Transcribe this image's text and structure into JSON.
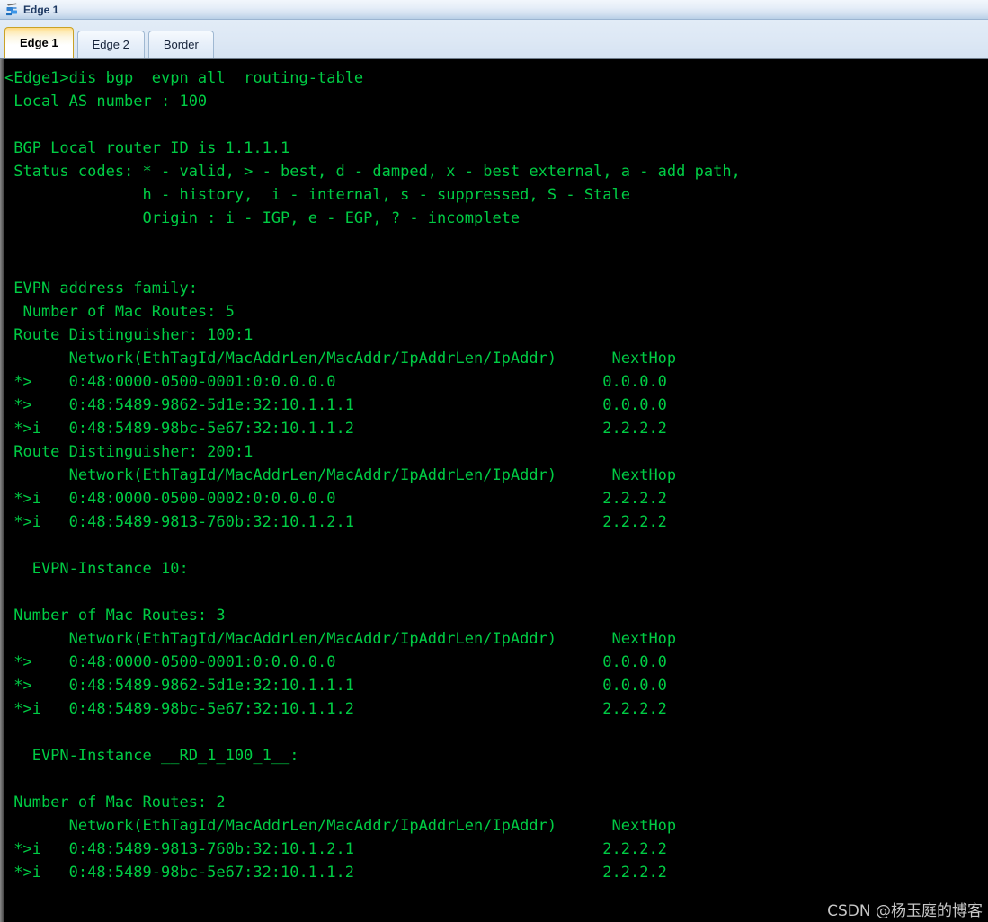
{
  "window": {
    "title": "Edge 1",
    "icon": "console-device-icon"
  },
  "tabs": [
    {
      "label": "Edge 1",
      "active": true
    },
    {
      "label": "Edge 2",
      "active": false
    },
    {
      "label": "Border",
      "active": false
    }
  ],
  "terminal": {
    "foreground_color": "#00cc44",
    "background_color": "#000000",
    "prompt": "<Edge1>",
    "command": "dis bgp  evpn all  routing-table",
    "lines": [
      "<Edge1>dis bgp  evpn all  routing-table",
      " Local AS number : 100",
      "",
      " BGP Local router ID is 1.1.1.1",
      " Status codes: * - valid, > - best, d - damped, x - best external, a - add path,",
      "               h - history,  i - internal, s - suppressed, S - Stale",
      "               Origin : i - IGP, e - EGP, ? - incomplete",
      "",
      "",
      " EVPN address family:",
      "  Number of Mac Routes: 5",
      " Route Distinguisher: 100:1",
      "       Network(EthTagId/MacAddrLen/MacAddr/IpAddrLen/IpAddr)      NextHop",
      " *>    0:48:0000-0500-0001:0:0.0.0.0                             0.0.0.0",
      " *>    0:48:5489-9862-5d1e:32:10.1.1.1                           0.0.0.0",
      " *>i   0:48:5489-98bc-5e67:32:10.1.1.2                           2.2.2.2",
      " Route Distinguisher: 200:1",
      "       Network(EthTagId/MacAddrLen/MacAddr/IpAddrLen/IpAddr)      NextHop",
      " *>i   0:48:0000-0500-0002:0:0.0.0.0                             2.2.2.2",
      " *>i   0:48:5489-9813-760b:32:10.1.2.1                           2.2.2.2",
      "",
      "   EVPN-Instance 10:",
      "",
      " Number of Mac Routes: 3",
      "       Network(EthTagId/MacAddrLen/MacAddr/IpAddrLen/IpAddr)      NextHop",
      " *>    0:48:0000-0500-0001:0:0.0.0.0                             0.0.0.0",
      " *>    0:48:5489-9862-5d1e:32:10.1.1.1                           0.0.0.0",
      " *>i   0:48:5489-98bc-5e67:32:10.1.1.2                           2.2.2.2",
      "",
      "   EVPN-Instance __RD_1_100_1__:",
      "",
      " Number of Mac Routes: 2",
      "       Network(EthTagId/MacAddrLen/MacAddr/IpAddrLen/IpAddr)      NextHop",
      " *>i   0:48:5489-9813-760b:32:10.1.2.1                           2.2.2.2",
      " *>i   0:48:5489-98bc-5e67:32:10.1.1.2                           2.2.2.2"
    ]
  },
  "watermark": {
    "text": "CSDN @杨玉庭的博客"
  }
}
